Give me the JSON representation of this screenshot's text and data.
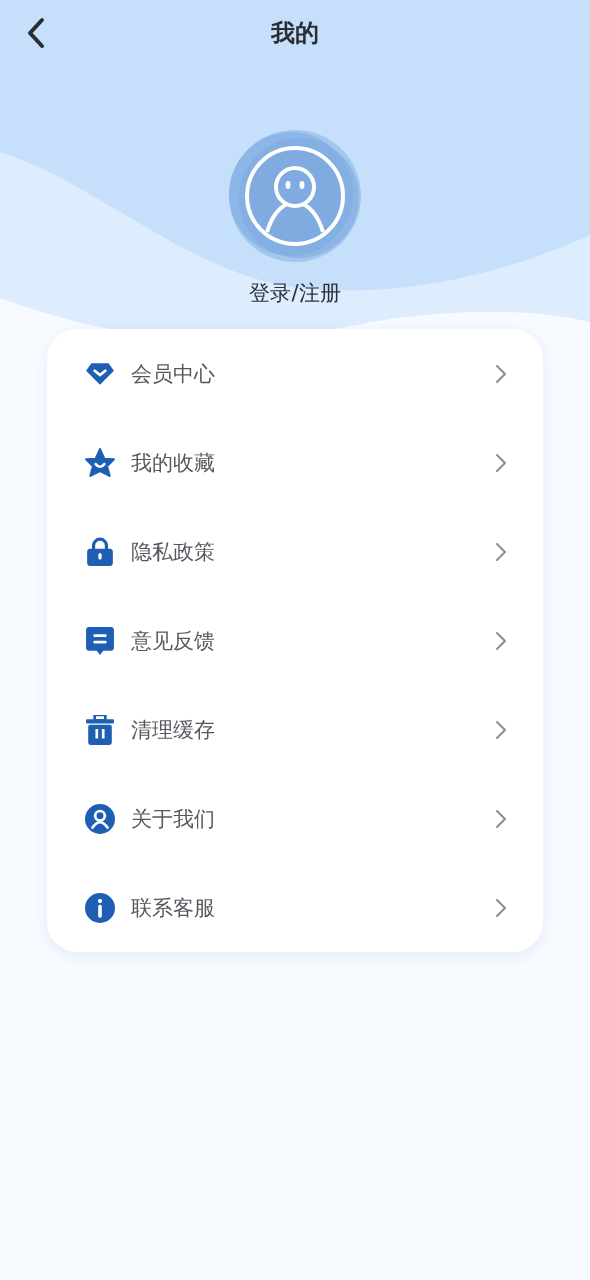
{
  "header": {
    "title": "我的"
  },
  "profile": {
    "login_label": "登录/注册"
  },
  "menu": [
    {
      "kind": "diamond",
      "label": "会员中心"
    },
    {
      "kind": "star",
      "label": "我的收藏"
    },
    {
      "kind": "lock",
      "label": "隐私政策"
    },
    {
      "kind": "chat",
      "label": "意见反馈"
    },
    {
      "kind": "trash",
      "label": "清理缓存"
    },
    {
      "kind": "person",
      "label": "关于我们"
    },
    {
      "kind": "info",
      "label": "联系客服"
    }
  ]
}
